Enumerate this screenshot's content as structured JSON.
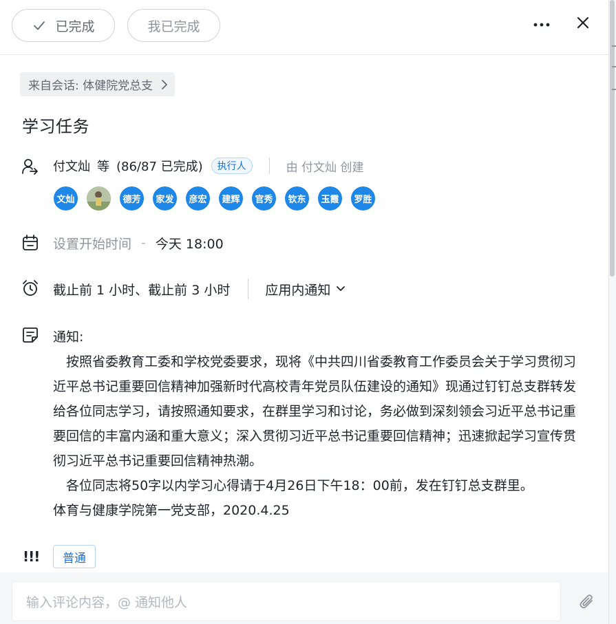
{
  "header": {
    "done_label": "已完成",
    "my_done_label": "我已完成"
  },
  "source": {
    "label": "来自会话: 体健院党总支"
  },
  "task": {
    "title": "学习任务"
  },
  "assignees": {
    "lead": "付文灿",
    "suffix": "等",
    "progress": "(86/87 已完成)",
    "role_tag": "执行人",
    "creator": "由 付文灿 创建",
    "avatars": [
      "文灿",
      "",
      "德芳",
      "家发",
      "彦宏",
      "建辉",
      "官秀",
      "钦东",
      "玉霞",
      "罗胜"
    ],
    "avatar_color": "#1f87e8"
  },
  "schedule": {
    "start_placeholder": "设置开始时间",
    "separator": "-",
    "due": "今天 18:00"
  },
  "reminder": {
    "text": "截止前 1 小时、截止前 3 小时",
    "channel": "应用内通知"
  },
  "note": {
    "heading": "通知:",
    "paragraph1": "　按照省委教育工委和学校党委要求，现将《中共四川省委教育工作委员会关于学习贯彻习近平总书记重要回信精神加强新时代高校青年党员队伍建设的通知》现通过钉钉总支群转发给各位同志学习，请按照通知要求，在群里学习和讨论，务必做到深刻领会习近平总书记重要回信的丰富内涵和重大意义；深入贯彻习近平总书记重要回信精神；迅速掀起学习宣传贯彻习近平总书记重要回信精神热潮。",
    "paragraph2": "　各位同志将50字以内学习心得请于4月26日下午18：00前，发在钉钉总支群里。",
    "signature": "体育与健康学院第一党支部，2020.4.25"
  },
  "priority": {
    "icon_text": "!!!",
    "label": "普通"
  },
  "comment": {
    "placeholder": "输入评论内容，@ 通知他人"
  },
  "colors": {
    "accent": "#1f6fd6",
    "muted": "#8f959e"
  }
}
